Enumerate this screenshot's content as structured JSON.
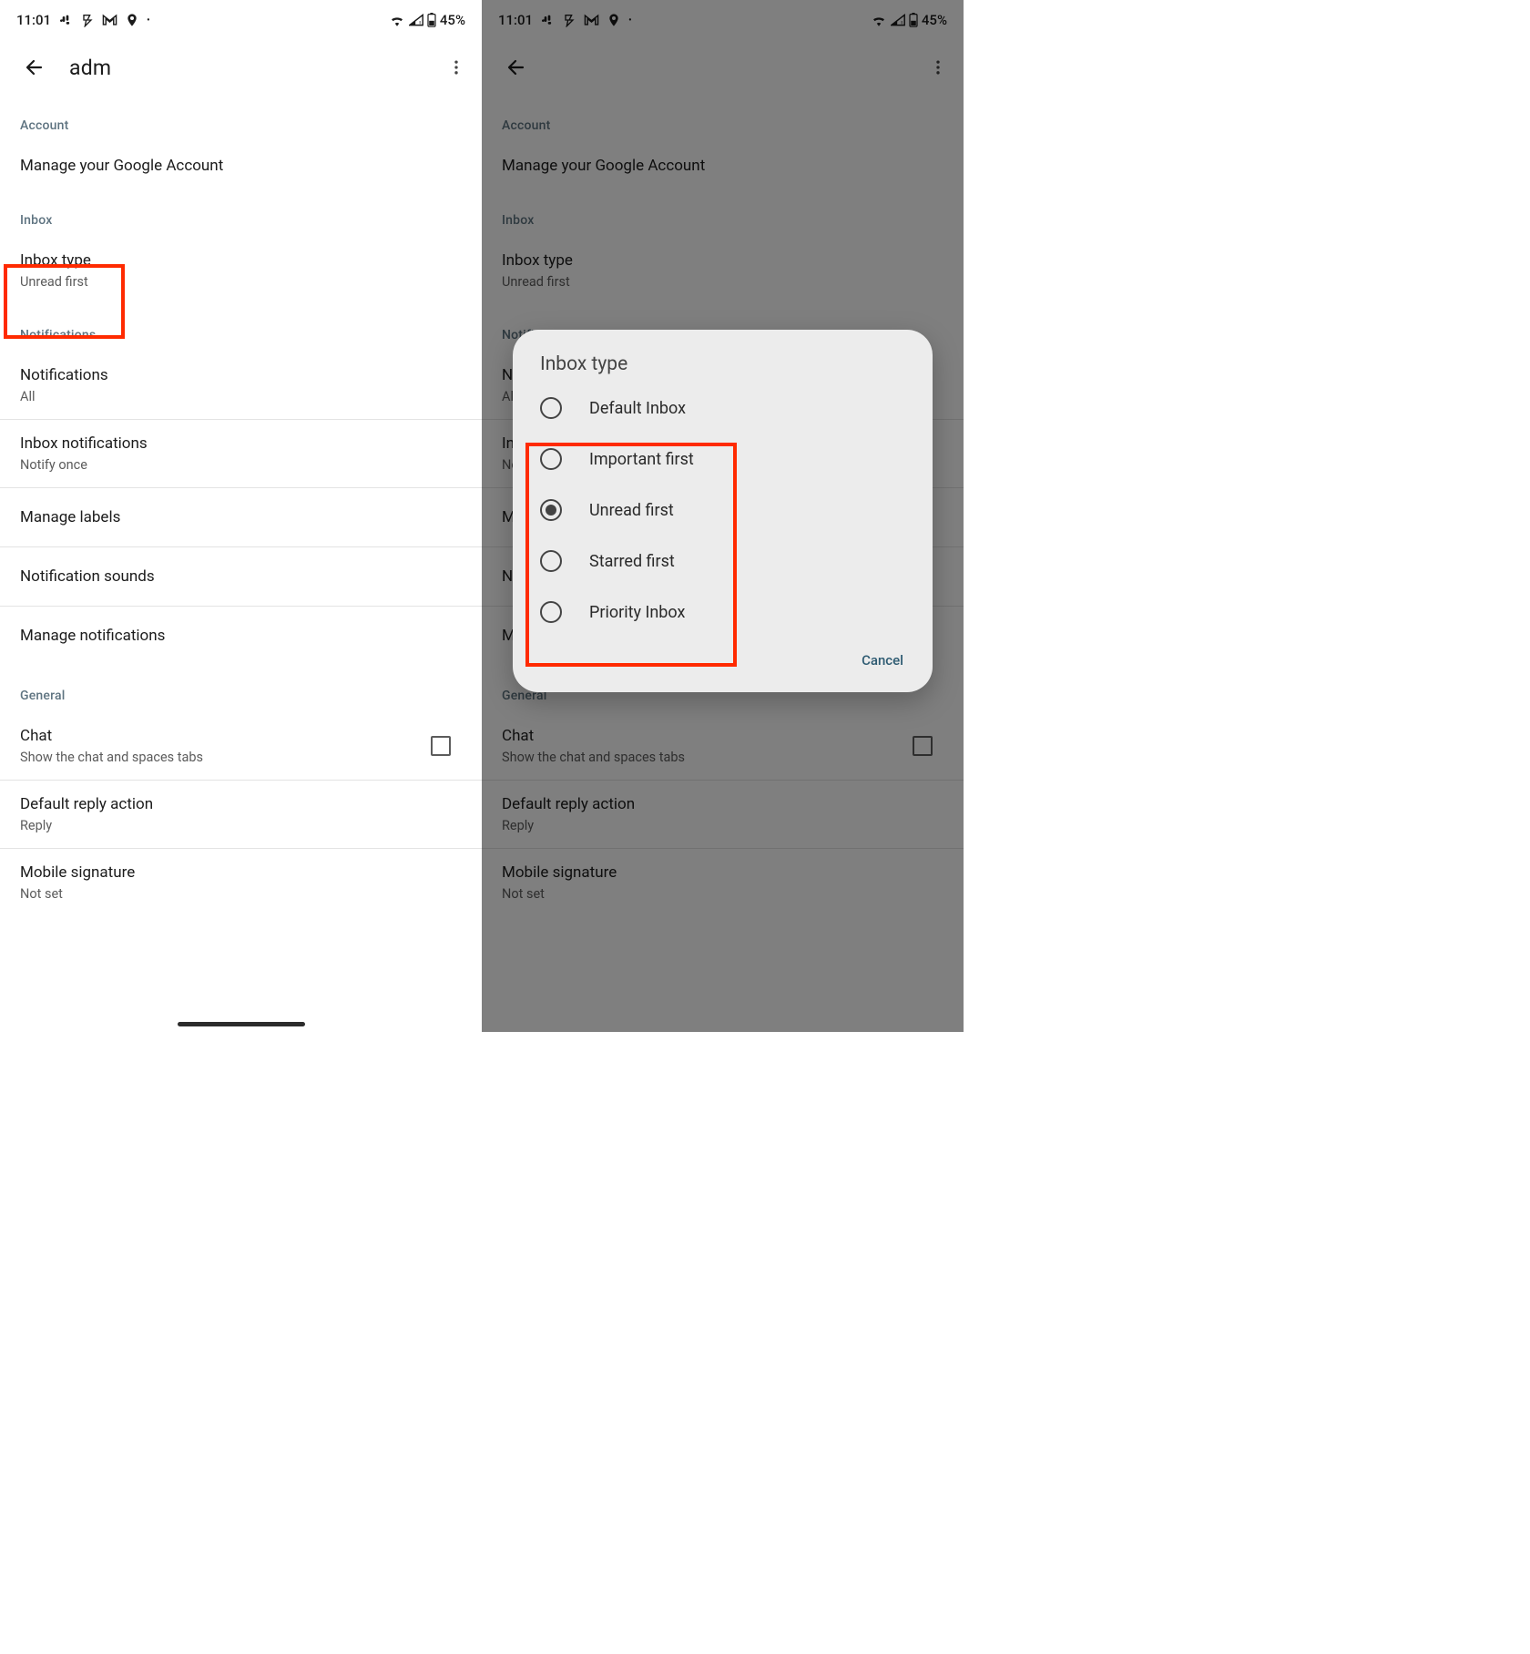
{
  "status": {
    "time": "11:01",
    "battery": "45%"
  },
  "header": {
    "title": "adm"
  },
  "sections": {
    "account": {
      "label": "Account",
      "manage": "Manage your Google Account"
    },
    "inbox": {
      "label": "Inbox",
      "inbox_type": {
        "title": "Inbox type",
        "sub": "Unread first"
      }
    },
    "notifications": {
      "label": "Notifications",
      "notifications": {
        "title": "Notifications",
        "sub": "All"
      },
      "inbox_notifications": {
        "title": "Inbox notifications",
        "sub": "Notify once"
      },
      "manage_labels": {
        "title": "Manage labels"
      },
      "notification_sounds": {
        "title": "Notification sounds"
      },
      "manage_notifications": {
        "title": "Manage notifications"
      }
    },
    "general": {
      "label": "General",
      "chat": {
        "title": "Chat",
        "sub": "Show the chat and spaces tabs"
      },
      "default_reply": {
        "title": "Default reply action",
        "sub": "Reply"
      },
      "mobile_signature": {
        "title": "Mobile signature",
        "sub": "Not set"
      }
    }
  },
  "dialog": {
    "title": "Inbox type",
    "options": {
      "0": "Default Inbox",
      "1": "Important first",
      "2": "Unread first",
      "3": "Starred first",
      "4": "Priority Inbox"
    },
    "cancel": "Cancel"
  }
}
